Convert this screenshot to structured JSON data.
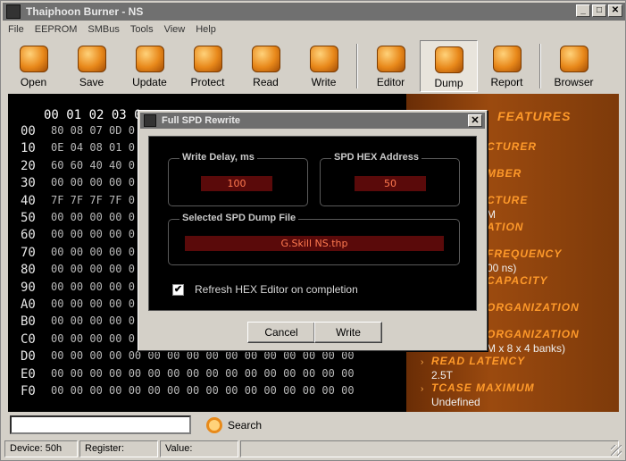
{
  "window": {
    "title": "Thaiphoon Burner - NS",
    "min": "_",
    "max": "□",
    "close": "✕"
  },
  "menu": [
    "File",
    "EEPROM",
    "SMBus",
    "Tools",
    "View",
    "Help"
  ],
  "toolbar": [
    {
      "label": "Open",
      "icon": "open-folder-icon"
    },
    {
      "label": "Save",
      "icon": "save-icon"
    },
    {
      "label": "Update",
      "icon": "update-icon"
    },
    {
      "label": "Protect",
      "icon": "lock-icon"
    },
    {
      "label": "Read",
      "icon": "read-icon"
    },
    {
      "label": "Write",
      "icon": "write-icon"
    },
    {
      "label": "Editor",
      "icon": "editor-icon"
    },
    {
      "label": "Dump",
      "icon": "dump-icon",
      "selected": true
    },
    {
      "label": "Report",
      "icon": "report-icon"
    },
    {
      "label": "Browser",
      "icon": "browser-icon"
    }
  ],
  "hex": {
    "header": "00 01 02 03 0",
    "rows": [
      {
        "addr": "00",
        "bytes": "80 08 07 0D 0"
      },
      {
        "addr": "10",
        "bytes": "0E 04 08 01 0"
      },
      {
        "addr": "20",
        "bytes": "60 60 40 40 0"
      },
      {
        "addr": "30",
        "bytes": "00 00 00 00 0"
      },
      {
        "addr": "40",
        "bytes": "7F 7F 7F 7F 0"
      },
      {
        "addr": "50",
        "bytes": "00 00 00 00 0"
      },
      {
        "addr": "60",
        "bytes": "00 00 00 00 0"
      },
      {
        "addr": "70",
        "bytes": "00 00 00 00 0"
      },
      {
        "addr": "80",
        "bytes": "00 00 00 00 0"
      },
      {
        "addr": "90",
        "bytes": "00 00 00 00 0"
      },
      {
        "addr": "A0",
        "bytes": "00 00 00 00 0"
      },
      {
        "addr": "B0",
        "bytes": "00 00 00 00 0"
      },
      {
        "addr": "C0",
        "bytes": "00 00 00 00 0"
      },
      {
        "addr": "D0",
        "bytes": "00 00 00 00 00 00 00 00 00 00 00 00 00 00 00 00"
      },
      {
        "addr": "E0",
        "bytes": "00 00 00 00 00 00 00 00 00 00 00 00 00 00 00 00"
      },
      {
        "addr": "F0",
        "bytes": "00 00 00 00 00 00 00 00 00 00 00 00 00 00 00 00"
      }
    ]
  },
  "features": {
    "title": "FEATURES",
    "h1": "CTURER",
    "h2": "MBER",
    "h3": "CTURE",
    "v3": "M",
    "h4": "ATION",
    "h5": "FREQUENCY",
    "v5": "00 ns)",
    "h6": "CAPACITY",
    "h7": "ORGANIZATION",
    "h8": "ORGANIZATION",
    "v8": "M x 8 x 4 banks)",
    "h9": "READ LATENCY",
    "v9": "2.5T",
    "h10": "TCASE MAXIMUM",
    "v10": "Undefined"
  },
  "search": {
    "value": "",
    "button": "Search"
  },
  "status": {
    "device": "Device: 50h",
    "register": "Register:",
    "value": "Value:"
  },
  "dialog": {
    "title": "Full SPD Rewrite",
    "close": "✕",
    "delay_label": "Write Delay, ms",
    "delay_value": "100",
    "addr_label": "SPD HEX Address",
    "addr_value": "50",
    "file_label": "Selected SPD Dump File",
    "file_value": "G.Skill NS.thp",
    "refresh_label": "Refresh HEX Editor on completion",
    "refresh_checked": true,
    "cancel": "Cancel",
    "write": "Write"
  }
}
